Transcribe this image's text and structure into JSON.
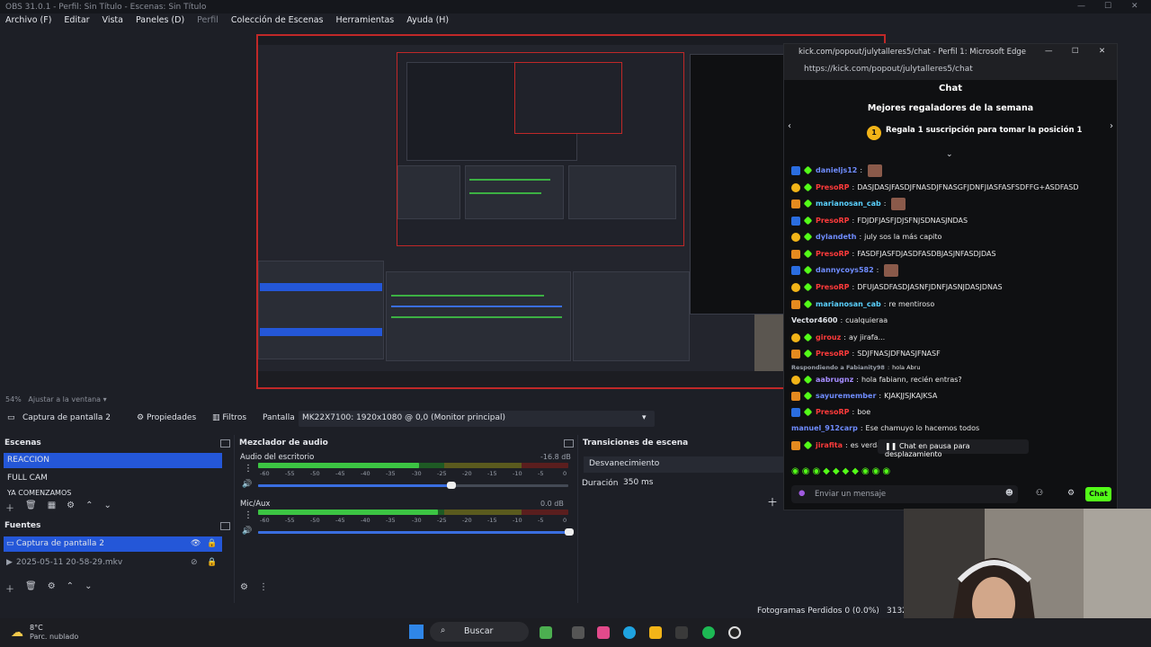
{
  "obs": {
    "title": "OBS 31.0.1 - Perfil: Sin Título - Escenas: Sin Título",
    "menu": [
      "Archivo (F)",
      "Editar",
      "Vista",
      "Paneles (D)",
      "Perfil",
      "Colección de Escenas",
      "Herramientas",
      "Ayuda (H)"
    ],
    "zoom_percent": "54%",
    "zoom_label": "Ajustar a la ventana",
    "source_toolbar": {
      "source_name": "Captura de pantalla 2",
      "properties": "Propiedades",
      "filters": "Filtros",
      "screen_label": "Pantalla",
      "monitor": "MK22X7100: 1920x1080 @ 0,0 (Monitor principal)"
    },
    "scenes": {
      "title": "Escenas",
      "items": [
        "REACCION",
        "FULL CAM",
        "YA COMENZAMOS"
      ]
    },
    "sources": {
      "title": "Fuentes",
      "items": [
        "Captura de pantalla 2",
        "2025-05-11 20-58-29.mkv"
      ]
    },
    "mixer": {
      "title": "Mezclador de audio",
      "tracks": [
        {
          "name": "Audio del escritorio",
          "db": "-16.8 dB",
          "level": 0.52,
          "volume": 0.62
        },
        {
          "name": "Mic/Aux",
          "db": "0.0 dB",
          "level": 0.58,
          "volume": 1.0
        }
      ],
      "scale": [
        "-60",
        "-55",
        "-50",
        "-45",
        "-40",
        "-35",
        "-30",
        "-25",
        "-20",
        "-15",
        "-10",
        "-5",
        "0"
      ]
    },
    "transitions": {
      "title": "Transiciones de escena",
      "selected": "Desvanecimiento",
      "duration_label": "Duración",
      "duration_value": "350 ms"
    },
    "status": {
      "dropped_frames": "Fotogramas Perdidos 0 (0.0%)",
      "counter": "3132"
    }
  },
  "edge": {
    "title": "kick.com/popout/julytalleres5/chat - Perfil 1: Microsoft Edge",
    "url": "https://kick.com/popout/julytalleres5/chat"
  },
  "chat": {
    "header": "Chat",
    "gifters_title": "Mejores regaladores de la semana",
    "gift_rank": "1",
    "gift_cta": "Regala 1 suscripción para tomar la posición 1",
    "messages": [
      {
        "user": "danieljs12",
        "color": "#6f8cff",
        "text": ""
      },
      {
        "user": "PresoRP",
        "color": "#ff3b3b",
        "text": "DASJDASJFASDJFNASDJFNASGFJDNFJIASFASFSDFFG+ASDFASD"
      },
      {
        "user": "marianosan_cab",
        "color": "#5ad1ff",
        "text": ""
      },
      {
        "user": "PresoRP",
        "color": "#ff3b3b",
        "text": "FDJDFJASFJDJSFNJSDNASJNDAS"
      },
      {
        "user": "dylandeth",
        "color": "#6f8cff",
        "text": "july sos la más capito"
      },
      {
        "user": "PresoRP",
        "color": "#ff3b3b",
        "text": "FASDFJASFDJASDFASDBJASJNFASDJDAS"
      },
      {
        "user": "dannycoys582",
        "color": "#6f8cff",
        "text": ""
      },
      {
        "user": "PresoRP",
        "color": "#ff3b3b",
        "text": "DFUJASDFASDJASNFJDNFJASNJDASJDNAS"
      },
      {
        "user": "marianosan_cab",
        "color": "#5ad1ff",
        "text": "re mentiroso"
      },
      {
        "user": "Vector4600",
        "color": "#dfe2e8",
        "text": "cualquieraa"
      },
      {
        "user": "girouz",
        "color": "#ff3b3b",
        "text": "ay jirafa..."
      },
      {
        "user": "PresoRP",
        "color": "#ff3b3b",
        "text": "SDJFNASJDFNASJFNASF"
      },
      {
        "user": "Respondiendo a Fabianity98",
        "color": "#9aa0ab",
        "text": "hola Abru"
      },
      {
        "user": "aabrugnz",
        "color": "#a58cff",
        "text": "hola fabiann, recién entras?"
      },
      {
        "user": "sayuremember",
        "color": "#6f8cff",
        "text": "KJAKJJSJKAJKSA"
      },
      {
        "user": "PresoRP",
        "color": "#ff3b3b",
        "text": "boe"
      },
      {
        "user": "manuel_912carp",
        "color": "#6f8cff",
        "text": "Ese chamuyo lo hacemos todos"
      },
      {
        "user": "jirafita",
        "color": "#ff3b3b",
        "text": "es verdad ig"
      }
    ],
    "paused": "Chat en pausa para desplazamiento",
    "input_placeholder": "Enviar un mensaje",
    "send": "Chat"
  },
  "taskbar": {
    "weather_temp": "8°C",
    "weather_desc": "Parc. nublado",
    "search": "Buscar"
  }
}
